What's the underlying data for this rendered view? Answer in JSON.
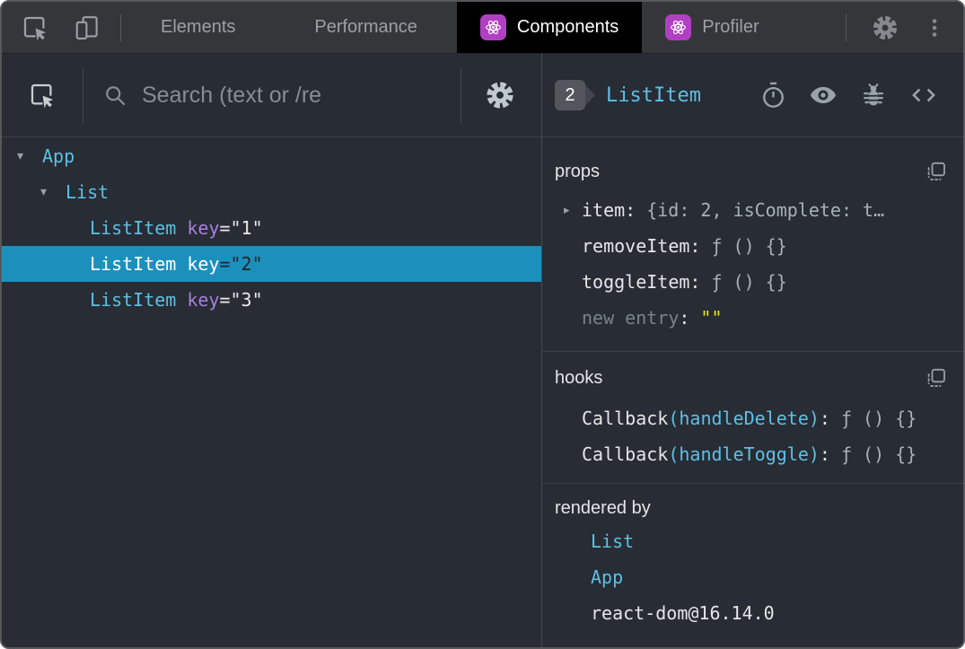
{
  "toolbar": {
    "tabs": [
      {
        "label": "Elements"
      },
      {
        "label": "Performance"
      },
      {
        "label": "Components"
      },
      {
        "label": "Profiler"
      }
    ]
  },
  "left_panel": {
    "search_placeholder": "Search (text or /re",
    "tree": [
      {
        "name": "App",
        "depth": 0,
        "expanded": true
      },
      {
        "name": "List",
        "depth": 1,
        "expanded": true
      },
      {
        "name": "ListItem",
        "depth": 2,
        "key_attr": "key",
        "key_value": "=\"1\"",
        "selected": false
      },
      {
        "name": "ListItem",
        "depth": 2,
        "key_attr": "key",
        "key_value": "=\"2\"",
        "selected": true
      },
      {
        "name": "ListItem",
        "depth": 2,
        "key_attr": "key",
        "key_value": "=\"3\"",
        "selected": false
      }
    ]
  },
  "right_panel": {
    "header": {
      "badge": "2",
      "component_name": "ListItem"
    },
    "props": {
      "title": "props",
      "rows": [
        {
          "name": "item",
          "colon": ":",
          "value": "{id: 2, isComplete: t…",
          "expandable": true
        },
        {
          "name": "removeItem",
          "colon": ":",
          "value": "ƒ () {}"
        },
        {
          "name": "toggleItem",
          "colon": ":",
          "value": "ƒ () {}"
        }
      ],
      "new_entry": {
        "name": "new entry",
        "colon": ":",
        "value": "\"\""
      }
    },
    "hooks": {
      "title": "hooks",
      "rows": [
        {
          "prefix": "Callback",
          "paren": "(handleDelete)",
          "colon": ":",
          "value": "ƒ () {}"
        },
        {
          "prefix": "Callback",
          "paren": "(handleToggle)",
          "colon": ":",
          "value": "ƒ () {}"
        }
      ]
    },
    "rendered_by": {
      "title": "rendered by",
      "items": [
        {
          "label": "List"
        },
        {
          "label": "App"
        },
        {
          "label": "react-dom@16.14.0"
        }
      ]
    }
  },
  "colors": {
    "panel_bg": "#282c34",
    "toolbar_bg": "#35363a",
    "accent_cyan": "#5dc0e6",
    "key_purple": "#a77fdd",
    "selected_row_bg": "#1b90bd",
    "empty_value_yellow": "#e8e807",
    "react_icon_purple": "#b13fc3",
    "active_tab_bg": "#000000"
  },
  "glyphs": {
    "expander_open": "▾",
    "expander_closed": "▸"
  }
}
